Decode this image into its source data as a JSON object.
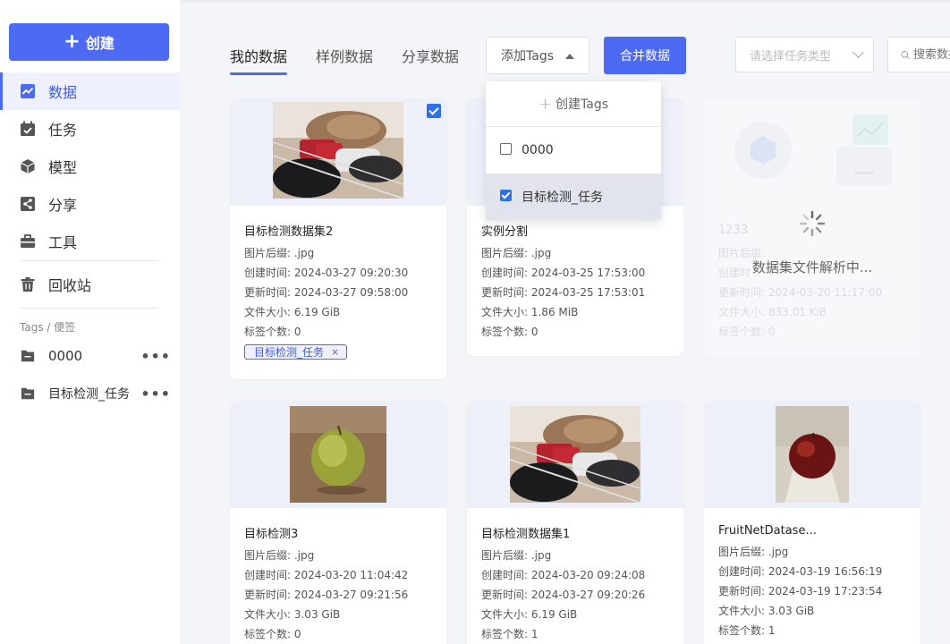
{
  "sidebar": {
    "create_label": "创建",
    "nav": [
      {
        "label": "数据",
        "icon": "chart-icon",
        "active": true
      },
      {
        "label": "任务",
        "icon": "calendar-icon",
        "active": false
      },
      {
        "label": "模型",
        "icon": "cube-icon",
        "active": false
      },
      {
        "label": "分享",
        "icon": "share-icon",
        "active": false
      },
      {
        "label": "工具",
        "icon": "toolbox-icon",
        "active": false
      }
    ],
    "recycle_label": "回收站",
    "tags_title": "Tags / 便签",
    "tags": [
      {
        "label": "0000"
      },
      {
        "label": "目标检测_任务"
      }
    ]
  },
  "tabs": [
    {
      "label": "我的数据",
      "active": true
    },
    {
      "label": "样例数据",
      "active": false
    },
    {
      "label": "分享数据",
      "active": false
    }
  ],
  "toolbar": {
    "add_tags_label": "添加Tags",
    "merge_label": "合并数据",
    "task_type_placeholder": "请选择任务类型",
    "search_placeholder": "搜索数据"
  },
  "dropdown": {
    "create_label": "创建Tags",
    "items": [
      {
        "label": "0000",
        "checked": false
      },
      {
        "label": "目标检测_任务",
        "checked": true
      }
    ]
  },
  "cards": [
    {
      "title": "目标检测数据集2",
      "suffix": "图片后缀: .jpg",
      "created": "创建时间: 2024-03-27 09:20:30",
      "updated": "更新时间: 2024-03-27 09:58:00",
      "size": "文件大小: 6.19 GiB",
      "labels": "标签个数: 0",
      "tag": "目标检测_任务",
      "checked": true,
      "image": "shoes-rack"
    },
    {
      "title": "实例分割",
      "suffix": "图片后缀: .jpg",
      "created": "创建时间: 2024-03-25 17:53:00",
      "updated": "更新时间: 2024-03-25 17:53:01",
      "size": "文件大小: 1.86 MiB",
      "labels": "标签个数: 0"
    },
    {
      "title": "目标检测3",
      "suffix": "图片后缀: .jpg",
      "created": "创建时间: 2024-03-20 11:04:42",
      "updated": "更新时间: 2024-03-27 09:21:56",
      "size": "文件大小: 3.03 GiB",
      "labels": "标签个数: 0",
      "image": "green-apple"
    },
    {
      "title": "目标检测数据集1",
      "suffix": "图片后缀: .jpg",
      "created": "创建时间: 2024-03-20 09:24:08",
      "updated": "更新时间: 2024-03-27 09:20:26",
      "size": "文件大小: 6.19 GiB",
      "labels": "标签个数: 1",
      "image": "shoes-rack"
    },
    {
      "title": "FruitNetDatase...",
      "suffix": "图片后缀: .jpg",
      "created": "创建时间: 2024-03-19 16:56:19",
      "updated": "更新时间: 2024-03-19 17:23:54",
      "size": "文件大小: 3.03 GiB",
      "labels": "标签个数: 1",
      "image": "red-apple"
    }
  ],
  "parsing_card": {
    "title": "1233",
    "suffix": "图片后缀:",
    "created": "创建时",
    "updated": "更新时间: 2024-03-20 11:17:00",
    "size": "文件大小: 833.01 KiB",
    "labels": "标签个数: 0",
    "status": "数据集文件解析中..."
  },
  "colors": {
    "accent": "#4d6bf2",
    "active_bg": "#eef1fd"
  }
}
